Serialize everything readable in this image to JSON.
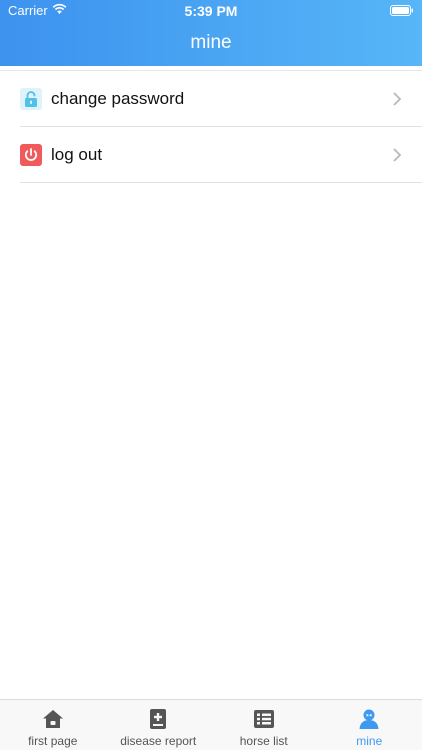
{
  "status_bar": {
    "carrier": "Carrier",
    "time": "5:39 PM"
  },
  "header": {
    "title": "mine"
  },
  "menu": {
    "items": [
      {
        "label": "change password",
        "icon": "lock-icon",
        "color": "#4fc1ea"
      },
      {
        "label": "log out",
        "icon": "power-icon",
        "color": "#f05a5a"
      }
    ]
  },
  "tabbar": {
    "active_color": "#3e9af0",
    "items": [
      {
        "label": "first page",
        "icon": "home-icon",
        "active": false
      },
      {
        "label": "disease report",
        "icon": "report-icon",
        "active": false
      },
      {
        "label": "horse list",
        "icon": "list-icon",
        "active": false
      },
      {
        "label": "mine",
        "icon": "user-icon",
        "active": true
      }
    ]
  }
}
